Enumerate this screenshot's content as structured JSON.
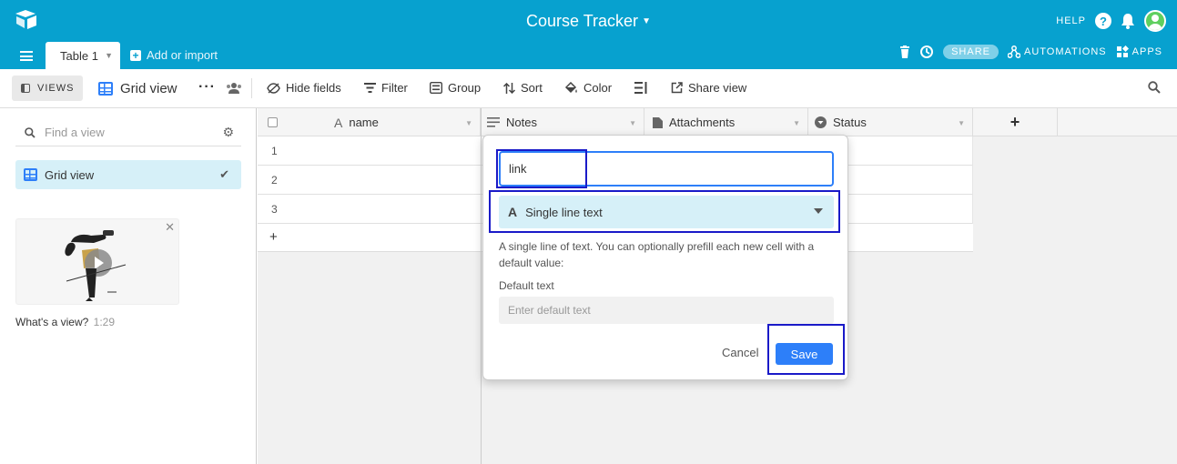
{
  "app": {
    "base_title": "Course Tracker",
    "help_label": "HELP"
  },
  "tabs": {
    "table_tab": "Table 1",
    "add_import": "Add or import",
    "share": "SHARE",
    "automations": "AUTOMATIONS",
    "apps": "APPS"
  },
  "viewbar": {
    "views_label": "VIEWS",
    "view_name": "Grid view",
    "hide_fields": "Hide fields",
    "filter": "Filter",
    "group": "Group",
    "sort": "Sort",
    "color": "Color",
    "share_view": "Share view"
  },
  "sidebar": {
    "find_placeholder": "Find a view",
    "views": [
      {
        "label": "Grid view"
      }
    ],
    "video_caption": "What's a view?",
    "video_duration": "1:29"
  },
  "grid": {
    "columns": [
      {
        "label": "name",
        "icon": "A"
      },
      {
        "label": "Notes",
        "icon": "notes-icon"
      },
      {
        "label": "Attachments",
        "icon": "file-icon"
      },
      {
        "label": "Status",
        "icon": "select-icon"
      }
    ],
    "rows": [
      "1",
      "2",
      "3"
    ]
  },
  "field_dialog": {
    "field_name_value": "link",
    "field_type": "Single line text",
    "type_description": "A single line of text. You can optionally prefill each new cell with a default value:",
    "default_label": "Default text",
    "default_placeholder": "Enter default text",
    "cancel_label": "Cancel",
    "save_label": "Save"
  },
  "colors": {
    "topbar": "#07a1cf",
    "accent": "#2d7ff9",
    "highlight": "#d6f0f8",
    "annotation_box": "#1a1ac8"
  }
}
